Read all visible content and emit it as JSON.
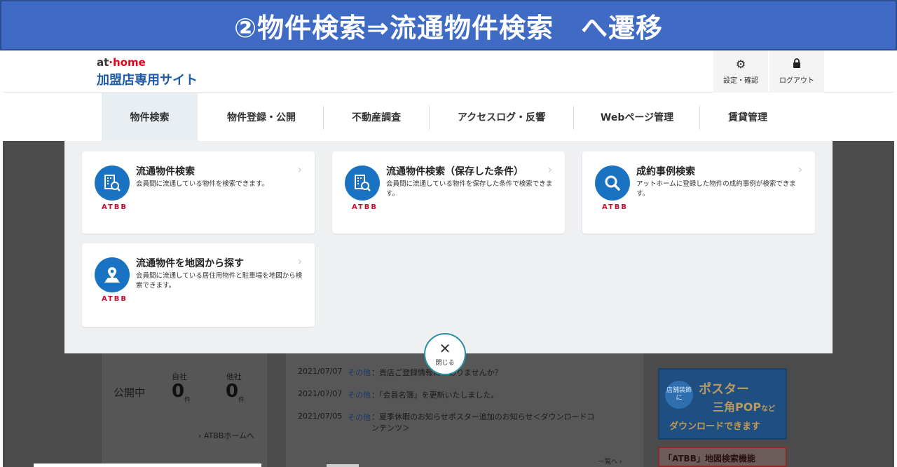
{
  "banner": {
    "text": "②物件検索⇒流通物件検索　へ遷移"
  },
  "header": {
    "logo_at": "at",
    "logo_home": "home",
    "logo_sub": "加盟店専用サイト",
    "settings_label": "設定・確認",
    "logout_label": "ログアウト"
  },
  "nav": {
    "items": [
      {
        "label": "物件検索"
      },
      {
        "label": "物件登録・公開"
      },
      {
        "label": "不動産調査"
      },
      {
        "label": "アクセスログ・反響"
      },
      {
        "label": "Webページ管理"
      },
      {
        "label": "賃貸管理"
      }
    ]
  },
  "cards": [
    {
      "title": "流通物件検索",
      "desc": "会員間に流通している物件を検索できます。",
      "badge": "ATBB",
      "icon": "building-search-icon"
    },
    {
      "title": "流通物件検索（保存した条件）",
      "desc": "会員間に流通している物件を保存した条件で検索できます。",
      "badge": "ATBB",
      "icon": "building-search-icon"
    },
    {
      "title": "成約事例検索",
      "desc": "アットホームに登録した物件の成約事例が検索できます。",
      "badge": "ATBB",
      "icon": "magnifier-icon"
    },
    {
      "title": "流通物件を地図から探す",
      "desc": "会員間に流通している居住用物件と駐車場を地図から検索できます。",
      "badge": "ATBB",
      "icon": "map-pin-icon"
    }
  ],
  "close": {
    "label": "閉じる"
  },
  "background": {
    "status_label": "公開中",
    "own_label": "自社",
    "other_label": "他社",
    "own_count": "0",
    "other_count": "0",
    "count_unit": "件",
    "atbb_link": "ATBBホームへ",
    "news": [
      {
        "date": "2021/07/07",
        "category": "その他",
        "text": "：貴店ご登録情報に　ありませんか？"
      },
      {
        "date": "2021/07/07",
        "category": "その他",
        "text": "：「会員名簿」を更新いたしました。"
      },
      {
        "date": "2021/07/05",
        "category": "その他",
        "text": "：夏季休暇のお知らせポスター追加のお知らせ＜ダウンロードコンテンツ＞"
      }
    ],
    "more_link": "一覧へ",
    "poster": {
      "circle": "店舗装飾に",
      "line1": "ポスター",
      "line2": "三角POP",
      "line2_suffix": "など",
      "line3": "ダウンロードできます"
    },
    "poster2": "「ATBB」地図検索機能"
  }
}
